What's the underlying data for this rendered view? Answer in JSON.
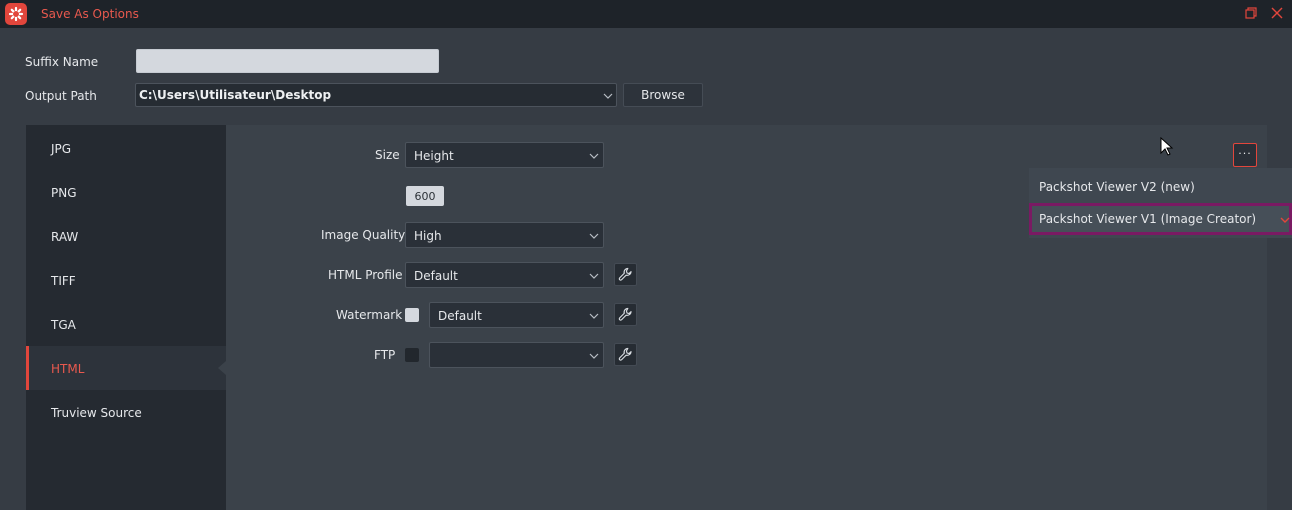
{
  "window": {
    "title": "Save As Options",
    "logo_icon": "app-logo-icon",
    "accent_color": "#e2463c",
    "controls": [
      "restore-icon",
      "close-icon"
    ]
  },
  "form": {
    "suffix_label": "Suffix Name",
    "suffix_value": "",
    "output_label": "Output Path",
    "output_value": "C:\\Users\\Utilisateur\\Desktop",
    "browse_label": "Browse"
  },
  "sidebar": {
    "items": [
      {
        "label": "JPG"
      },
      {
        "label": "PNG"
      },
      {
        "label": "RAW"
      },
      {
        "label": "TIFF"
      },
      {
        "label": "TGA"
      },
      {
        "label": "HTML"
      },
      {
        "label": "Truview Source"
      }
    ],
    "active": "HTML"
  },
  "html_settings": {
    "size_label": "Size",
    "size_value": "Height",
    "size_number": "600",
    "quality_label": "Image Quality",
    "quality_value": "High",
    "profile_label": "HTML Profile",
    "profile_value": "Default",
    "watermark_label": "Watermark",
    "watermark_checked": false,
    "watermark_value": "Default",
    "ftp_label": "FTP",
    "ftp_checked": false,
    "ftp_value": ""
  },
  "more_menu": {
    "button_label": "···",
    "items": [
      {
        "label": "Packshot Viewer V2 (new)"
      },
      {
        "label": "Packshot Viewer V1 (Image Creator)"
      }
    ],
    "selected_index": 1
  }
}
